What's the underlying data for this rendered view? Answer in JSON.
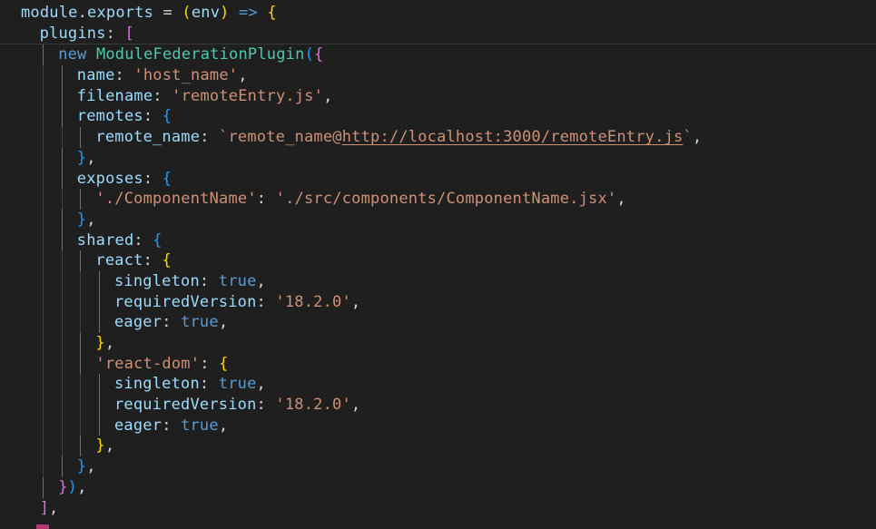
{
  "editor": {
    "lines": [
      {
        "indent": 0,
        "tokens": [
          {
            "t": "module",
            "c": "tok-ident"
          },
          {
            "t": ".",
            "c": "tok-plain"
          },
          {
            "t": "exports",
            "c": "tok-ident"
          },
          {
            "t": " = ",
            "c": "tok-plain"
          },
          {
            "t": "(",
            "c": "tok-br1"
          },
          {
            "t": "env",
            "c": "tok-ident"
          },
          {
            "t": ")",
            "c": "tok-br1"
          },
          {
            "t": " => ",
            "c": "tok-op"
          },
          {
            "t": "{",
            "c": "tok-br1"
          }
        ]
      },
      {
        "indent": 1,
        "tokens": [
          {
            "t": "plugins",
            "c": "tok-prop"
          },
          {
            "t": ": ",
            "c": "tok-plain"
          },
          {
            "t": "[",
            "c": "tok-br2"
          }
        ]
      },
      {
        "indent": 2,
        "tokens": [
          {
            "t": "new ",
            "c": "tok-kw"
          },
          {
            "t": "ModuleFederationPlugin",
            "c": "tok-class"
          },
          {
            "t": "(",
            "c": "tok-br3"
          },
          {
            "t": "{",
            "c": "tok-br2"
          }
        ]
      },
      {
        "indent": 3,
        "tokens": [
          {
            "t": "name",
            "c": "tok-prop"
          },
          {
            "t": ": ",
            "c": "tok-plain"
          },
          {
            "t": "'host_name'",
            "c": "tok-str"
          },
          {
            "t": ",",
            "c": "tok-plain"
          }
        ]
      },
      {
        "indent": 3,
        "tokens": [
          {
            "t": "filename",
            "c": "tok-prop"
          },
          {
            "t": ": ",
            "c": "tok-plain"
          },
          {
            "t": "'remoteEntry.js'",
            "c": "tok-str"
          },
          {
            "t": ",",
            "c": "tok-plain"
          }
        ]
      },
      {
        "indent": 3,
        "tokens": [
          {
            "t": "remotes",
            "c": "tok-prop"
          },
          {
            "t": ": ",
            "c": "tok-plain"
          },
          {
            "t": "{",
            "c": "tok-br3"
          }
        ]
      },
      {
        "indent": 4,
        "tokens": [
          {
            "t": "remote_name",
            "c": "tok-prop"
          },
          {
            "t": ": ",
            "c": "tok-plain"
          },
          {
            "t": "`remote_name@",
            "c": "tok-str"
          },
          {
            "t": "http://localhost:3000/remoteEntry.js",
            "c": "tok-link"
          },
          {
            "t": "`",
            "c": "tok-str"
          },
          {
            "t": ",",
            "c": "tok-plain"
          }
        ]
      },
      {
        "indent": 3,
        "tokens": [
          {
            "t": "}",
            "c": "tok-br3"
          },
          {
            "t": ",",
            "c": "tok-plain"
          }
        ]
      },
      {
        "indent": 3,
        "tokens": [
          {
            "t": "exposes",
            "c": "tok-prop"
          },
          {
            "t": ": ",
            "c": "tok-plain"
          },
          {
            "t": "{",
            "c": "tok-br3"
          }
        ]
      },
      {
        "indent": 4,
        "tokens": [
          {
            "t": "'./ComponentName'",
            "c": "tok-str"
          },
          {
            "t": ": ",
            "c": "tok-plain"
          },
          {
            "t": "'./src/components/ComponentName.jsx'",
            "c": "tok-str"
          },
          {
            "t": ",",
            "c": "tok-plain"
          }
        ]
      },
      {
        "indent": 3,
        "tokens": [
          {
            "t": "}",
            "c": "tok-br3"
          },
          {
            "t": ",",
            "c": "tok-plain"
          }
        ]
      },
      {
        "indent": 3,
        "tokens": [
          {
            "t": "shared",
            "c": "tok-prop"
          },
          {
            "t": ": ",
            "c": "tok-plain"
          },
          {
            "t": "{",
            "c": "tok-br3"
          }
        ]
      },
      {
        "indent": 4,
        "tokens": [
          {
            "t": "react",
            "c": "tok-prop"
          },
          {
            "t": ": ",
            "c": "tok-plain"
          },
          {
            "t": "{",
            "c": "tok-br1"
          }
        ]
      },
      {
        "indent": 5,
        "tokens": [
          {
            "t": "singleton",
            "c": "tok-prop"
          },
          {
            "t": ": ",
            "c": "tok-plain"
          },
          {
            "t": "true",
            "c": "tok-bool"
          },
          {
            "t": ",",
            "c": "tok-plain"
          }
        ]
      },
      {
        "indent": 5,
        "tokens": [
          {
            "t": "requiredVersion",
            "c": "tok-prop"
          },
          {
            "t": ": ",
            "c": "tok-plain"
          },
          {
            "t": "'18.2.0'",
            "c": "tok-str"
          },
          {
            "t": ",",
            "c": "tok-plain"
          }
        ]
      },
      {
        "indent": 5,
        "tokens": [
          {
            "t": "eager",
            "c": "tok-prop"
          },
          {
            "t": ": ",
            "c": "tok-plain"
          },
          {
            "t": "true",
            "c": "tok-bool"
          },
          {
            "t": ",",
            "c": "tok-plain"
          }
        ]
      },
      {
        "indent": 4,
        "tokens": [
          {
            "t": "}",
            "c": "tok-br1"
          },
          {
            "t": ",",
            "c": "tok-plain"
          }
        ]
      },
      {
        "indent": 4,
        "tokens": [
          {
            "t": "'react-dom'",
            "c": "tok-str"
          },
          {
            "t": ": ",
            "c": "tok-plain"
          },
          {
            "t": "{",
            "c": "tok-br1"
          }
        ]
      },
      {
        "indent": 5,
        "tokens": [
          {
            "t": "singleton",
            "c": "tok-prop"
          },
          {
            "t": ": ",
            "c": "tok-plain"
          },
          {
            "t": "true",
            "c": "tok-bool"
          },
          {
            "t": ",",
            "c": "tok-plain"
          }
        ]
      },
      {
        "indent": 5,
        "tokens": [
          {
            "t": "requiredVersion",
            "c": "tok-prop"
          },
          {
            "t": ": ",
            "c": "tok-plain"
          },
          {
            "t": "'18.2.0'",
            "c": "tok-str"
          },
          {
            "t": ",",
            "c": "tok-plain"
          }
        ]
      },
      {
        "indent": 5,
        "tokens": [
          {
            "t": "eager",
            "c": "tok-prop"
          },
          {
            "t": ": ",
            "c": "tok-plain"
          },
          {
            "t": "true",
            "c": "tok-bool"
          },
          {
            "t": ",",
            "c": "tok-plain"
          }
        ]
      },
      {
        "indent": 4,
        "tokens": [
          {
            "t": "}",
            "c": "tok-br1"
          },
          {
            "t": ",",
            "c": "tok-plain"
          }
        ]
      },
      {
        "indent": 3,
        "tokens": [
          {
            "t": "}",
            "c": "tok-br3"
          },
          {
            "t": ",",
            "c": "tok-plain"
          }
        ]
      },
      {
        "indent": 2,
        "tokens": [
          {
            "t": "}",
            "c": "tok-br2"
          },
          {
            "t": ")",
            "c": "tok-br3"
          },
          {
            "t": ",",
            "c": "tok-plain"
          }
        ]
      },
      {
        "indent": 1,
        "tokens": [
          {
            "t": "]",
            "c": "tok-br2"
          },
          {
            "t": ",",
            "c": "tok-plain"
          }
        ]
      }
    ]
  },
  "colors": {
    "background": "#1f1f1f",
    "property": "#9cdcfe",
    "keyword": "#569cd6",
    "class": "#4ec9b0",
    "string": "#ce9178",
    "bracket_gold": "#ffd700",
    "bracket_orchid": "#da70d6",
    "bracket_blue": "#179fff"
  }
}
